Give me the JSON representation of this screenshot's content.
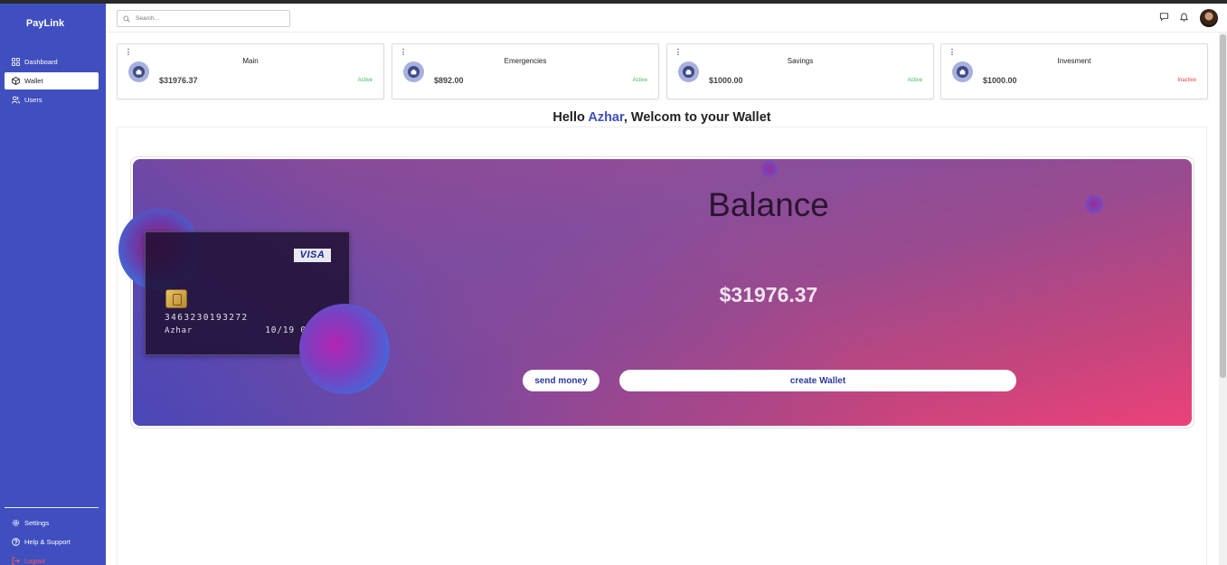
{
  "brand": "PayLink",
  "sidebar": {
    "items": [
      {
        "label": "Dashboard",
        "icon": "grid-icon"
      },
      {
        "label": "Wallet",
        "icon": "box-icon",
        "active": true
      },
      {
        "label": "Users",
        "icon": "users-icon"
      }
    ],
    "bottom": [
      {
        "label": "Settings",
        "icon": "gear-icon"
      },
      {
        "label": "Help & Support",
        "icon": "help-icon"
      },
      {
        "label": "Logout",
        "icon": "logout-icon"
      }
    ]
  },
  "header": {
    "search_placeholder": "Search...",
    "icons": [
      "chat-icon",
      "bell-icon",
      "avatar"
    ]
  },
  "wallets": [
    {
      "menu": "⋮",
      "name": "Main",
      "amount": "$31976.37",
      "status": "Active"
    },
    {
      "menu": "⋮",
      "name": "Emergencies",
      "amount": "$892.00",
      "status": "Active"
    },
    {
      "menu": "⋮",
      "name": "Savings",
      "amount": "$1000.00",
      "status": "Active"
    },
    {
      "menu": "⋮",
      "name": "Invesment",
      "amount": "$1000.00",
      "status": "Inactive"
    }
  ],
  "greeting": {
    "prefix": "Hello ",
    "user": "Azhar",
    "suffix": ", Welcom to your Wallet"
  },
  "card": {
    "brand": "VISA",
    "number": "3463230193272",
    "holder": "Azhar",
    "dates": "10/19 06/21"
  },
  "balance": {
    "title": "Balance",
    "amount": "$31976.37"
  },
  "actions": {
    "send": "send money",
    "create": "create Wallet"
  },
  "colors": {
    "sidebar": "#3f4fc0",
    "active_status": "#3cba54",
    "inactive_status": "#e84040",
    "accent": "#3f4fc0",
    "panel_pink": "#ec417a"
  }
}
